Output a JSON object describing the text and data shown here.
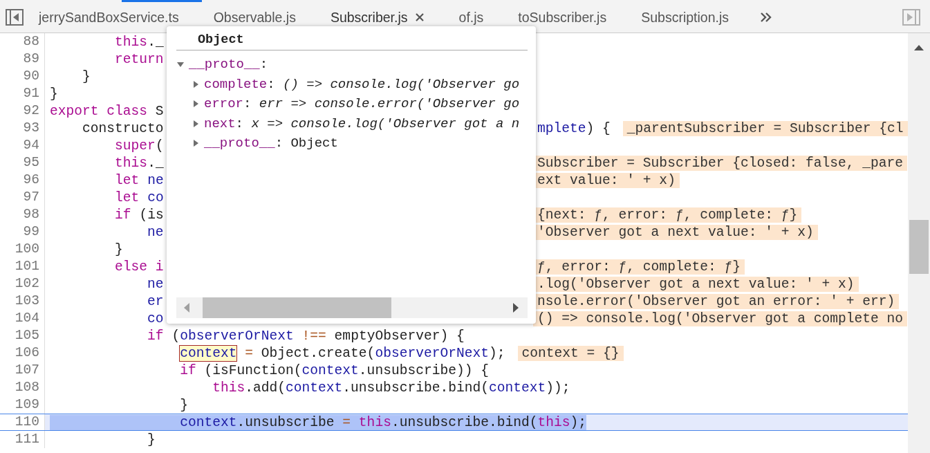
{
  "tabs": [
    {
      "label": "jerrySandBoxService.ts",
      "selected": false
    },
    {
      "label": "Observable.js",
      "selected": false
    },
    {
      "label": "Subscriber.js",
      "selected": true
    },
    {
      "label": "of.js",
      "selected": false
    },
    {
      "label": "toSubscriber.js",
      "selected": false
    },
    {
      "label": "Subscription.js",
      "selected": false
    }
  ],
  "code": {
    "lines": [
      {
        "number": "88",
        "current": false,
        "tokens": [
          {
            "kind": "keyword",
            "text": "        this"
          },
          {
            "kind": "plain",
            "text": "._"
          }
        ]
      },
      {
        "number": "89",
        "current": false,
        "tokens": [
          {
            "kind": "keyword",
            "text": "        return"
          }
        ]
      },
      {
        "number": "90",
        "current": false,
        "tokens": [
          {
            "kind": "plain",
            "text": "    }"
          }
        ]
      },
      {
        "number": "91",
        "current": false,
        "tokens": [
          {
            "kind": "plain",
            "text": "}"
          }
        ]
      },
      {
        "number": "92",
        "current": false,
        "tokens": [
          {
            "kind": "keyword",
            "text": "export class "
          },
          {
            "kind": "plain",
            "text": "S"
          }
        ]
      },
      {
        "number": "93",
        "current": false,
        "tokens": [
          {
            "kind": "plain",
            "text": "    constructo"
          }
        ],
        "tail": [
          {
            "kind": "variable",
            "text": "mplete"
          },
          {
            "kind": "plain",
            "text": ") {"
          }
        ],
        "value": "_parentSubscriber = Subscriber {cl"
      },
      {
        "number": "94",
        "current": false,
        "tokens": [
          {
            "kind": "keyword",
            "text": "        super"
          },
          {
            "kind": "plain",
            "text": "("
          }
        ]
      },
      {
        "number": "95",
        "current": false,
        "tokens": [
          {
            "kind": "keyword",
            "text": "        this"
          },
          {
            "kind": "plain",
            "text": "._"
          }
        ],
        "value": "Subscriber = Subscriber {closed: false, _pare"
      },
      {
        "number": "96",
        "current": false,
        "tokens": [
          {
            "kind": "keyword",
            "text": "        let "
          },
          {
            "kind": "variable",
            "text": "ne"
          }
        ],
        "value": "ext value: ' + x)"
      },
      {
        "number": "97",
        "current": false,
        "tokens": [
          {
            "kind": "keyword",
            "text": "        let "
          },
          {
            "kind": "variable",
            "text": "co"
          }
        ]
      },
      {
        "number": "98",
        "current": false,
        "tokens": [
          {
            "kind": "keyword",
            "text": "        if"
          },
          {
            "kind": "plain",
            "text": " (is"
          }
        ],
        "value": "{next: ƒ, error: ƒ, complete: ƒ}"
      },
      {
        "number": "99",
        "current": false,
        "tokens": [
          {
            "kind": "variable",
            "text": "            ne"
          }
        ],
        "value": "'Observer got a next value: ' + x)"
      },
      {
        "number": "100",
        "current": false,
        "tokens": [
          {
            "kind": "plain",
            "text": "        }"
          }
        ]
      },
      {
        "number": "101",
        "current": false,
        "tokens": [
          {
            "kind": "keyword",
            "text": "        else i"
          }
        ],
        "value": "ƒ, error: ƒ, complete: ƒ}"
      },
      {
        "number": "102",
        "current": false,
        "tokens": [
          {
            "kind": "variable",
            "text": "            ne"
          }
        ],
        "value": ".log('Observer got a next value: ' + x)"
      },
      {
        "number": "103",
        "current": false,
        "tokens": [
          {
            "kind": "variable",
            "text": "            er"
          }
        ],
        "value": "nsole.error('Observer got an error: ' + err)"
      },
      {
        "number": "104",
        "current": false,
        "tokens": [
          {
            "kind": "variable",
            "text": "            co"
          }
        ],
        "value": "() => console.log('Observer got a complete no"
      },
      {
        "number": "105",
        "current": false,
        "tokens": [
          {
            "kind": "keyword",
            "text": "            if"
          },
          {
            "kind": "plain",
            "text": " ("
          },
          {
            "kind": "variable",
            "text": "observerOrNext"
          },
          {
            "kind": "operator",
            "text": " !== "
          },
          {
            "kind": "plain",
            "text": "emptyObserver) {"
          }
        ]
      },
      {
        "number": "106",
        "current": false,
        "tokens": [
          {
            "kind": "hovered",
            "text": "                context"
          },
          {
            "kind": "operator",
            "text": " = "
          },
          {
            "kind": "plain",
            "text": "Object.create("
          },
          {
            "kind": "variable",
            "text": "observerOrNext"
          },
          {
            "kind": "plain",
            "text": ");"
          }
        ],
        "value": "context = {}"
      },
      {
        "number": "107",
        "current": false,
        "tokens": [
          {
            "kind": "keyword",
            "text": "                if"
          },
          {
            "kind": "plain",
            "text": " (isFunction("
          },
          {
            "kind": "variable",
            "text": "context"
          },
          {
            "kind": "plain",
            "text": ".unsubscribe)) {"
          }
        ]
      },
      {
        "number": "108",
        "current": false,
        "tokens": [
          {
            "kind": "keyword",
            "text": "                    this"
          },
          {
            "kind": "plain",
            "text": ".add("
          },
          {
            "kind": "variable",
            "text": "context"
          },
          {
            "kind": "plain",
            "text": ".unsubscribe.bind("
          },
          {
            "kind": "variable",
            "text": "context"
          },
          {
            "kind": "plain",
            "text": "));"
          }
        ]
      },
      {
        "number": "109",
        "current": false,
        "tokens": [
          {
            "kind": "plain",
            "text": "                }"
          }
        ]
      },
      {
        "number": "110",
        "current": true,
        "tokens": [
          {
            "kind": "variable",
            "text": "                context"
          },
          {
            "kind": "plain",
            "text": ".unsubscribe"
          },
          {
            "kind": "operator",
            "text": " = "
          },
          {
            "kind": "keyword",
            "text": "this"
          },
          {
            "kind": "plain",
            "text": ".unsubscribe.bind("
          },
          {
            "kind": "keyword",
            "text": "this"
          },
          {
            "kind": "plain",
            "text": ");"
          }
        ]
      },
      {
        "number": "111",
        "current": false,
        "tokens": [
          {
            "kind": "plain",
            "text": "            }"
          }
        ]
      }
    ]
  },
  "popover": {
    "title": "Object",
    "tree": [
      {
        "name": "__proto__",
        "colon": ":",
        "expanded": true,
        "children": [
          {
            "name": "complete",
            "colon": ":",
            "kind": "function",
            "value": "() => console.log('Observer go",
            "expanded": false
          },
          {
            "name": "error",
            "colon": ":",
            "kind": "function",
            "value": "err => console.error('Observer go",
            "expanded": false
          },
          {
            "name": "next",
            "colon": ":",
            "kind": "function",
            "value": "x => console.log('Observer got a n",
            "expanded": false
          },
          {
            "name": "__proto__",
            "colon": ":",
            "kind": "object",
            "value": "Object",
            "expanded": false
          }
        ]
      }
    ]
  }
}
